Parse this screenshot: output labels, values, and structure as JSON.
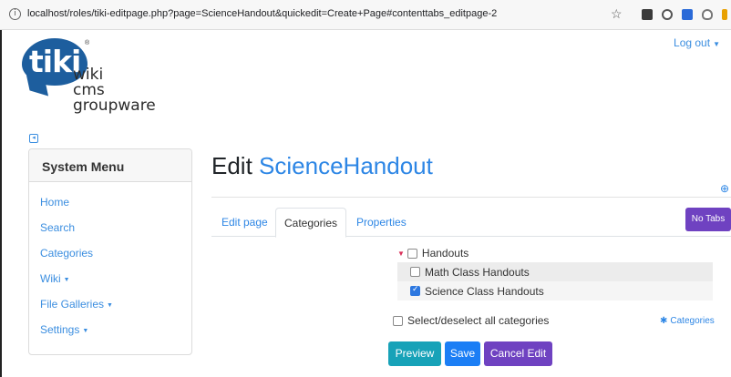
{
  "browser": {
    "url": "localhost/roles/tiki-editpage.php?page=ScienceHandout&quickedit=Create+Page#contenttabs_editpage-2",
    "info_icon": "i"
  },
  "header": {
    "logout_label": "Log out",
    "logo": {
      "mark": "tiki",
      "lines": [
        "wiki",
        "cms",
        "groupware"
      ]
    }
  },
  "sidebar": {
    "title": "System Menu",
    "items": [
      {
        "label": "Home",
        "has_dropdown": false
      },
      {
        "label": "Search",
        "has_dropdown": false
      },
      {
        "label": "Categories",
        "has_dropdown": false
      },
      {
        "label": "Wiki",
        "has_dropdown": true
      },
      {
        "label": "File Galleries",
        "has_dropdown": true
      },
      {
        "label": "Settings",
        "has_dropdown": true
      }
    ]
  },
  "main": {
    "title_prefix": "Edit",
    "page_name": "ScienceHandout",
    "tabs": [
      {
        "label": "Edit page",
        "active": false
      },
      {
        "label": "Categories",
        "active": true
      },
      {
        "label": "Properties",
        "active": false
      }
    ],
    "no_tabs_label": "No Tabs",
    "categories": {
      "root": {
        "label": "Handouts",
        "checked": false
      },
      "children": [
        {
          "label": "Math Class Handouts",
          "checked": false
        },
        {
          "label": "Science Class Handouts",
          "checked": true
        }
      ],
      "select_all_label": "Select/deselect all categories",
      "categories_link": "Categories"
    },
    "buttons": {
      "preview": "Preview",
      "save": "Save",
      "cancel": "Cancel Edit"
    }
  },
  "colors": {
    "link": "#2d86e5",
    "purple": "#6f42c1",
    "teal": "#17a2b8",
    "blue": "#1b7ef5"
  }
}
